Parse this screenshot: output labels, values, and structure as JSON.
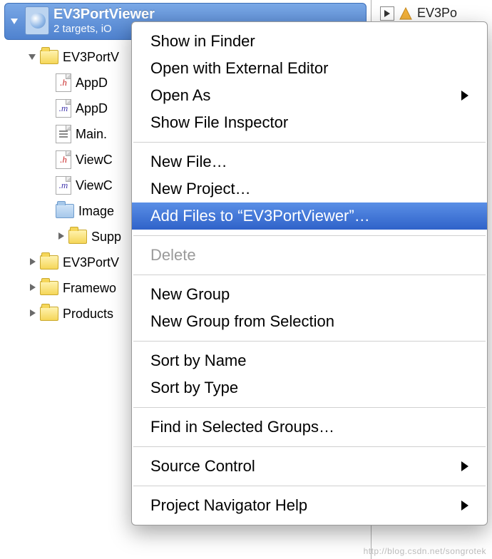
{
  "project": {
    "title": "EV3PortViewer",
    "subtitle": "2 targets, iO"
  },
  "right_tab_label": "EV3Po",
  "tree": {
    "group_main": "EV3PortV",
    "file_appdelegate_h": "AppD",
    "file_appdelegate_m": "AppD",
    "file_main_story": "Main.",
    "file_viewc_h": "ViewC",
    "file_viewc_m": "ViewC",
    "file_images": "Image",
    "group_supporting": "Supp",
    "group_tests": "EV3PortV",
    "group_frameworks": "Framewo",
    "group_products": "Products"
  },
  "menu": {
    "show_in_finder": "Show in Finder",
    "open_external": "Open with External Editor",
    "open_as": "Open As",
    "show_file_inspector": "Show File Inspector",
    "new_file": "New File…",
    "new_project": "New Project…",
    "add_files": "Add Files to “EV3PortViewer”…",
    "delete": "Delete",
    "new_group": "New Group",
    "new_group_selection": "New Group from Selection",
    "sort_name": "Sort by Name",
    "sort_type": "Sort by Type",
    "find_in_groups": "Find in Selected Groups…",
    "source_control": "Source Control",
    "project_nav_help": "Project Navigator Help"
  },
  "watermark": "http://blog.csdn.net/songrotek"
}
